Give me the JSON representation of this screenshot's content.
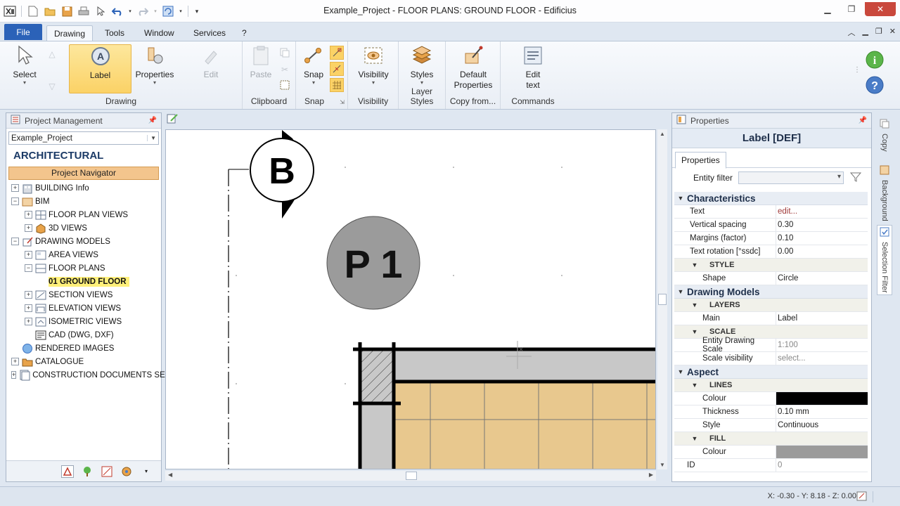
{
  "window": {
    "title": "Example_Project -  FLOOR PLANS: GROUND FLOOR - Edificius"
  },
  "ribbon_tabs": {
    "file": "File",
    "drawing": "Drawing",
    "tools": "Tools",
    "window": "Window",
    "services": "Services",
    "help": "?"
  },
  "ribbon": {
    "select": "Select",
    "label": "Label",
    "properties": "Properties",
    "edit": "Edit",
    "drawing_group": "Drawing",
    "paste": "Paste",
    "clipboard_group": "Clipboard",
    "snap": "Snap",
    "snap_group": "Snap",
    "visibility": "Visibility",
    "visibility_group": "Visibility",
    "styles": "Styles",
    "layer_styles_group": "Layer Styles",
    "default_properties_1": "Default",
    "default_properties_2": "Properties",
    "copy_from_group": "Copy from...",
    "edit_text_1": "Edit",
    "edit_text_2": "text",
    "commands_group": "Commands"
  },
  "left_panel": {
    "title": "Project Management",
    "project_combo": "Example_Project",
    "section_title": "ARCHITECTURAL",
    "navigator": "Project Navigator",
    "tree": [
      {
        "label": "BUILDING Info",
        "expander": "+",
        "indent": 0
      },
      {
        "label": "BIM",
        "expander": "−",
        "indent": 0
      },
      {
        "label": "FLOOR PLAN VIEWS",
        "expander": "+",
        "indent": 1
      },
      {
        "label": "3D VIEWS",
        "expander": "+",
        "indent": 1
      },
      {
        "label": "DRAWING MODELS",
        "expander": "−",
        "indent": 0
      },
      {
        "label": "AREA VIEWS",
        "expander": "+",
        "indent": 1
      },
      {
        "label": "FLOOR PLANS",
        "expander": "−",
        "indent": 1
      },
      {
        "label": "01 GROUND FLOOR",
        "expander": "",
        "indent": 2
      },
      {
        "label": "SECTION VIEWS",
        "expander": "+",
        "indent": 1
      },
      {
        "label": "ELEVATION VIEWS",
        "expander": "+",
        "indent": 1
      },
      {
        "label": "ISOMETRIC VIEWS",
        "expander": "+",
        "indent": 1
      },
      {
        "label": "CAD (DWG, DXF)",
        "expander": "",
        "indent": 1
      },
      {
        "label": "RENDERED IMAGES",
        "expander": "",
        "indent": 0
      },
      {
        "label": "CATALOGUE",
        "expander": "+",
        "indent": 0
      },
      {
        "label": "CONSTRUCTION DOCUMENTS SET",
        "expander": "+",
        "indent": 0
      }
    ]
  },
  "canvas": {
    "section_marker": "B",
    "label_text": "P 1"
  },
  "right_panel": {
    "title": "Properties",
    "header": "Label [DEF]",
    "tab": "Properties",
    "entity_filter": "Entity filter",
    "rows": {
      "characteristics": "Characteristics",
      "text_key": "Text",
      "text_val": "edit...",
      "vspacing_key": "Vertical spacing",
      "vspacing_val": "0.30",
      "margins_key": "Margins (factor)",
      "margins_val": "0.10",
      "rotation_key": "Text rotation  [°ssdc]",
      "rotation_val": "0.00",
      "style_sub": "STYLE",
      "shape_key": "Shape",
      "shape_val": "Circle",
      "drawing_models": "Drawing Models",
      "layers_sub": "LAYERS",
      "main_key": "Main",
      "main_val": "Label",
      "scale_sub": "SCALE",
      "eds_key": "Entity Drawing Scale",
      "eds_val": "1:100",
      "scalevis_key": "Scale visibility",
      "scalevis_val": "select...",
      "aspect": "Aspect",
      "lines_sub": "LINES",
      "colour_key": "Colour",
      "thickness_key": "Thickness",
      "thickness_val": "0.10 mm",
      "style_key": "Style",
      "style_val": "Continuous",
      "fill_sub": "FILL",
      "fill_colour_key": "Colour",
      "id_key": "ID",
      "id_val": "0"
    }
  },
  "side_tabs": {
    "copy": "Copy",
    "background": "Background",
    "selection_filter": "Selection Filter"
  },
  "status": {
    "coords": "X: -0.30 - Y: 8.18 - Z: 0.00"
  },
  "colors": {
    "accent": "#2b62b8",
    "selected_tree": "#fff07a",
    "navigator": "#f3c58d",
    "tile": "#e8c88e",
    "label_fill": "#9b9b9b",
    "line_colour": "#000000",
    "fill_colour": "#9b9b9b"
  }
}
